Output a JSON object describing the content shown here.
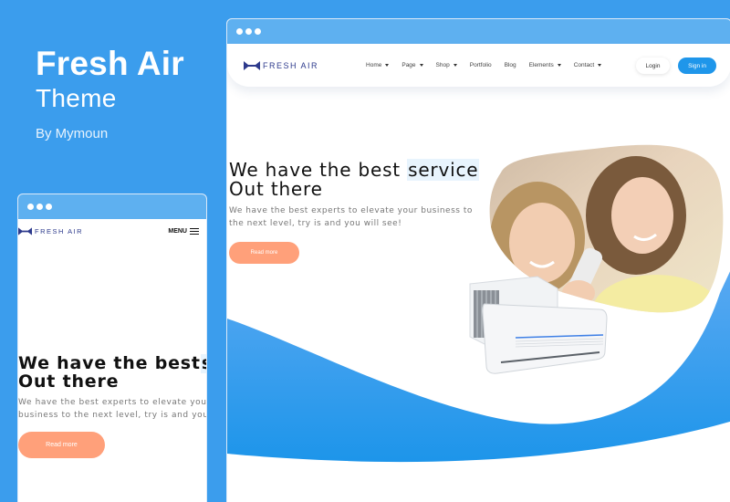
{
  "promo": {
    "title": "Fresh Air",
    "subtitle": "Theme",
    "author": "By Mymoun"
  },
  "colors": {
    "background": "#3b9ded",
    "window_bar": "#5eb0f0",
    "brand_navy": "#2d3a8c",
    "accent_blue": "#1f96ea",
    "cta_peach": "#ffa07a"
  },
  "desktop": {
    "logo_text": "FRESH AIR",
    "menu": [
      {
        "label": "Home",
        "has_dropdown": true
      },
      {
        "label": "Page",
        "has_dropdown": true
      },
      {
        "label": "Shop",
        "has_dropdown": true
      },
      {
        "label": "Portfolio",
        "has_dropdown": false
      },
      {
        "label": "Blog",
        "has_dropdown": false
      },
      {
        "label": "Elements",
        "has_dropdown": true
      },
      {
        "label": "Contact",
        "has_dropdown": true
      }
    ],
    "login_label": "Login",
    "signin_label": "Sign in",
    "hero": {
      "title_part1": "We have the best ",
      "title_highlight": "service",
      "title_line2": "Out there",
      "text": "We have the best experts to elevate your business to the next level, try is and you will see!",
      "button_label": "Read more",
      "image_alt": "Two smiling girls holding an air conditioner remote, with split AC units"
    }
  },
  "mobile": {
    "logo_text": "FRESH AIR",
    "menu_label": "MENU",
    "hero": {
      "title_part1": "We have the best",
      "title_highlight": "se",
      "title_line2": "Out there",
      "text_line1": "We have the best experts to elevate your",
      "text_line2": "business to the next level, try is and you",
      "button_label": "Read more"
    }
  }
}
